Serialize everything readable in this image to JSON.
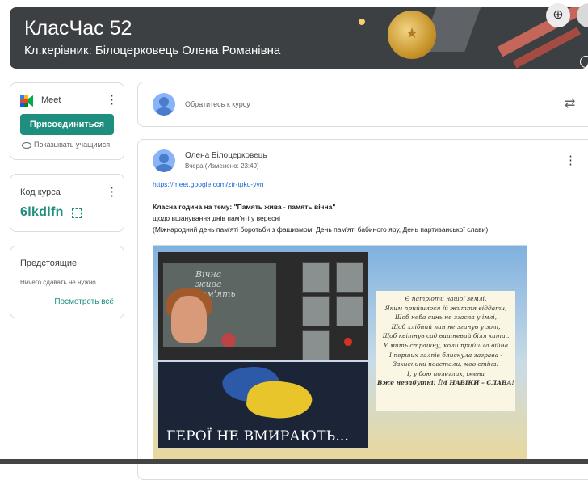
{
  "banner": {
    "title": "КласЧас 52",
    "subtitle": "Кл.керівник: Білоцерковець Олена Романівна",
    "zoom_icon": "zoom-in-icon",
    "info_icon": "info-icon"
  },
  "meet": {
    "title": "Meet",
    "join_label": "Присоединиться",
    "show_students_label": "Показывать учащимся"
  },
  "course_code": {
    "label": "Код курса",
    "value": "6lkdlfn"
  },
  "upcoming": {
    "title": "Предстоящие",
    "empty_text": "Ничего сдавать не нужно",
    "view_all": "Посмотреть всё"
  },
  "share": {
    "placeholder": "Обратитесь к курсу"
  },
  "post": {
    "author": "Олена Білоцерковець",
    "time": "Вчера (Изменено: 23:49)",
    "link": "https://meet.google.com/ztr-tpku-yvn",
    "heading": "Класна година на тему: \"Память жива - память вічна\"",
    "line1": "щодо вшанування днів пам'яті у вересні",
    "line2": "(Міжнародний день пам'яті боротьби з фашизмом, День пам'яті бабиного яру, День партизанської слави)"
  },
  "image": {
    "heroes_text": "ГЕРОЇ НЕ ВМИРАЮТЬ...",
    "poem": [
      "Є патріоти нашої землі,",
      "Яким прийшлося їй життя віддати,",
      "Щоб неба синь не згасла у імлі,",
      "Щоб хлібний лан не згинув у золі,",
      "Щоб квітнув сад вишневий біля хати..",
      "У мить страшну, коли прийшла війна",
      "І перших залпів блиснула заграва -",
      "Захисники повстали, мов стіна!",
      "І, у бою полеглих, імена",
      "Вже незабутні: ЇМ НАВІКИ – СЛАВА!"
    ]
  },
  "colors": {
    "accent": "#1e8e7e",
    "banner_bg": "#3c4043",
    "link": "#1967d2"
  }
}
